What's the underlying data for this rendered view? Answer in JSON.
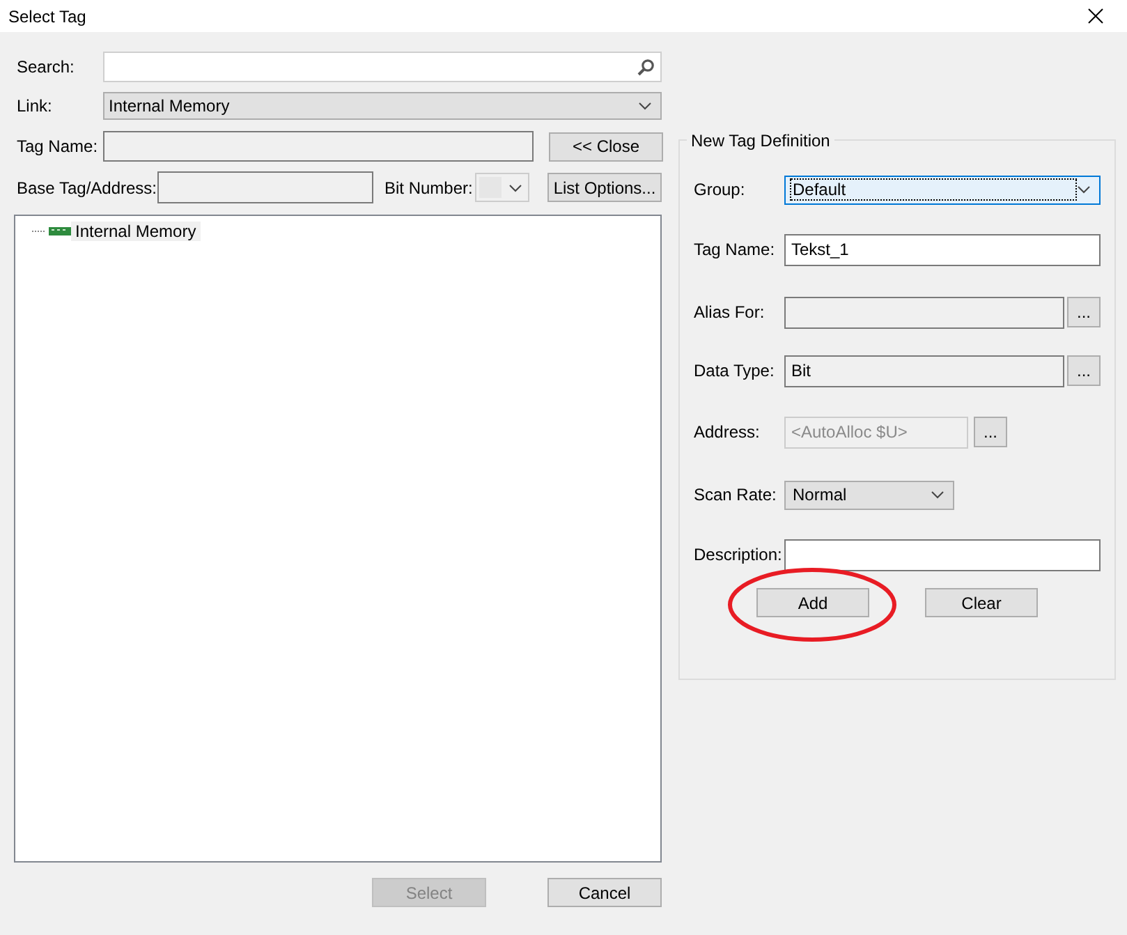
{
  "window": {
    "title": "Select Tag"
  },
  "search": {
    "label": "Search:"
  },
  "link": {
    "label": "Link:",
    "value": "Internal Memory"
  },
  "tag_name": {
    "label": "Tag Name:",
    "disabled": true
  },
  "close_button": "<< Close",
  "base_tag": {
    "label": "Base Tag/Address:",
    "disabled": true
  },
  "bit_number": {
    "label": "Bit Number:",
    "disabled": true
  },
  "list_options_button": "List Options...",
  "tree": [
    {
      "label": "Internal Memory",
      "selected": true
    }
  ],
  "footer_buttons": [
    {
      "label": "Select",
      "disabled": true
    },
    {
      "label": "Cancel",
      "disabled": false
    }
  ],
  "new_tag": {
    "title": "New Tag Definition",
    "rows": [
      {
        "kind": "combo",
        "label": "Group:",
        "value": "Default",
        "focused": true
      },
      {
        "kind": "text",
        "label": "Tag Name:",
        "value": "Tekst_1"
      },
      {
        "kind": "browse",
        "label": "Alias For:",
        "button": "...",
        "disabled": false
      },
      {
        "kind": "browse",
        "label": "Data Type:",
        "value": "Bit",
        "button": "...",
        "disabled": false
      },
      {
        "kind": "browse",
        "label": "Address:",
        "value": "<AutoAlloc $U>",
        "button": "...",
        "disabled": true
      },
      {
        "kind": "combo",
        "label": "Scan Rate:",
        "value": "Normal",
        "focused": false
      },
      {
        "kind": "text",
        "label": "Description:"
      }
    ],
    "buttons": [
      {
        "label": "Add",
        "circled": true
      },
      {
        "label": "Clear",
        "circled": false
      }
    ]
  }
}
